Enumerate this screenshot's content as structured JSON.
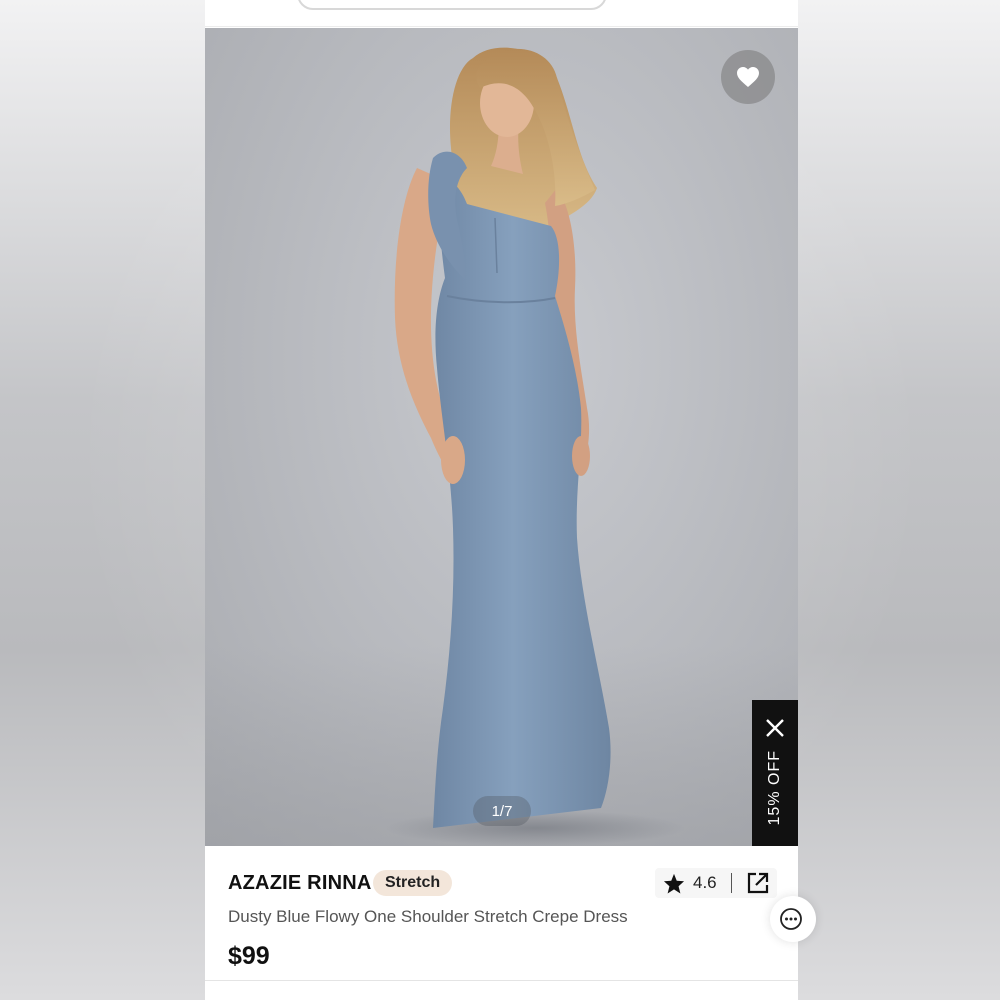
{
  "product": {
    "brand": "AZAZIE RINNA",
    "tag": "Stretch",
    "title": "Dusty Blue Flowy One Shoulder Stretch Crepe Dress",
    "price": "$99",
    "rating": "4.6"
  },
  "gallery": {
    "pager": "1/7",
    "image_subject": "model wearing dusty blue one-shoulder mermaid gown"
  },
  "promo": {
    "label": "15% OFF"
  },
  "icons": {
    "favorite": "heart-icon",
    "close": "close-icon",
    "star": "star-icon",
    "share": "share-icon",
    "more": "more-icon"
  },
  "colors": {
    "dress": "#7f97b4",
    "promo_bg": "#111111",
    "tag_bg": "#f3e6da"
  }
}
